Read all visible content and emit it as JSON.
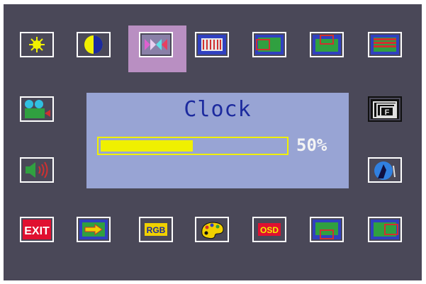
{
  "osd": {
    "title": "Clock",
    "progress_text": "50%",
    "progress_value": 0.5
  },
  "icons": {
    "top_row": [
      "brightness-icon",
      "contrast-icon",
      "clock-icon",
      "phase-icon",
      "h-position-icon",
      "v-position-icon",
      "size-icon"
    ],
    "left_column": [
      "video-input-icon",
      "volume-icon"
    ],
    "right_column": [
      "aspect-icon",
      "auto-adjust-icon"
    ],
    "bottom_row": [
      "exit-icon",
      "input-source-icon",
      "rgb-icon",
      "color-palette-icon",
      "osd-icon",
      "v-position-down-icon",
      "h-position-right-icon"
    ]
  },
  "labels": {
    "exit": "EXIT",
    "rgb": "RGB",
    "osd": "OSD",
    "f": "F"
  },
  "colors": {
    "background": "#4a4858",
    "panel": "#98a4d4",
    "accent_yellow": "#f0f000",
    "title_blue": "#1c2a9e",
    "selection": "#b98fc2"
  }
}
